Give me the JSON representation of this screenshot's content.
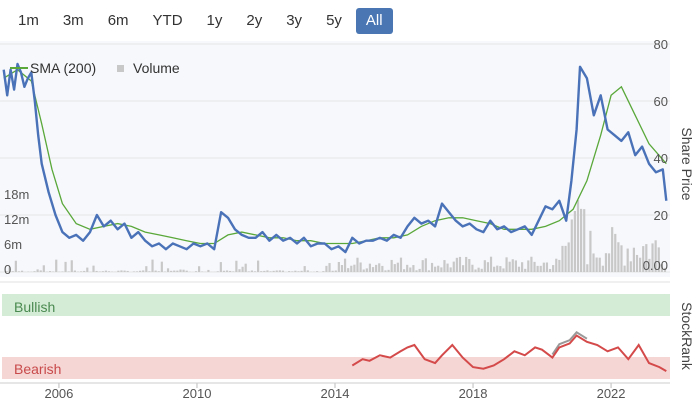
{
  "range_selector": {
    "buttons": [
      "1m",
      "3m",
      "6m",
      "YTD",
      "1y",
      "2y",
      "3y",
      "5y",
      "All"
    ],
    "active": "All"
  },
  "colors": {
    "price": "#4a72b8",
    "sma": "#5aa83a",
    "volume": "#c8c8c8",
    "stockrank_recent": "#d44a4a",
    "stockrank_old": "#999999",
    "bullish_fill": "#d4ecd6",
    "bearish_fill": "#f6d5d5",
    "bullish_text": "#4a8a50",
    "bearish_text": "#c84a4a",
    "button_active": "#4a77b4"
  },
  "chart_data": [
    {
      "type": "line",
      "y_right_label": "Share Price",
      "y_right_ticks": [
        "80",
        "60",
        "40",
        "20",
        "0.00"
      ],
      "y_left_ticks": [
        "18m",
        "12m",
        "6m",
        "0"
      ],
      "x_ticks": [
        "2006",
        "2010",
        "2014",
        "2018",
        "2022"
      ],
      "ylim": [
        0,
        80
      ],
      "volume_ylim": [
        0,
        24
      ],
      "legend": [
        "SMA (200)",
        "Volume"
      ],
      "series": [
        {
          "name": "Share Price",
          "x": [
            2004.4,
            2004.5,
            2004.6,
            2004.7,
            2004.8,
            2004.9,
            2005.0,
            2005.1,
            2005.2,
            2005.3,
            2005.4,
            2005.5,
            2005.7,
            2005.9,
            2006.1,
            2006.3,
            2006.5,
            2006.7,
            2006.9,
            2007.1,
            2007.3,
            2007.5,
            2007.7,
            2007.9,
            2008.1,
            2008.3,
            2008.5,
            2008.7,
            2008.9,
            2009.1,
            2009.3,
            2009.5,
            2009.7,
            2009.9,
            2010.1,
            2010.3,
            2010.5,
            2010.7,
            2010.9,
            2011.1,
            2011.3,
            2011.5,
            2011.7,
            2011.9,
            2012.1,
            2012.3,
            2012.5,
            2012.7,
            2012.9,
            2013.1,
            2013.3,
            2013.5,
            2013.7,
            2013.9,
            2014.1,
            2014.3,
            2014.5,
            2014.7,
            2014.9,
            2015.1,
            2015.3,
            2015.5,
            2015.7,
            2015.9,
            2016.1,
            2016.3,
            2016.5,
            2016.7,
            2016.9,
            2017.1,
            2017.3,
            2017.5,
            2017.7,
            2017.9,
            2018.1,
            2018.3,
            2018.5,
            2018.7,
            2018.9,
            2019.1,
            2019.3,
            2019.5,
            2019.7,
            2019.9,
            2020.1,
            2020.3,
            2020.5,
            2020.7,
            2020.85,
            2021.0,
            2021.1,
            2021.3,
            2021.5,
            2021.7,
            2021.9,
            2022.1,
            2022.3,
            2022.5,
            2022.7,
            2022.9,
            2023.1,
            2023.3,
            2023.5,
            2023.6
          ],
          "values": [
            71,
            62,
            71,
            64,
            73,
            70,
            65,
            68,
            70,
            60,
            48,
            38,
            28,
            20,
            14,
            12,
            13,
            11,
            14,
            20,
            16,
            18,
            15,
            17,
            12,
            14,
            11,
            9,
            10,
            8,
            10,
            9,
            8,
            10,
            9,
            10,
            8,
            21,
            19,
            15,
            13,
            12,
            12,
            14,
            11,
            13,
            11,
            12,
            10,
            12,
            9,
            10,
            10,
            8,
            9,
            7,
            12,
            10,
            11,
            11,
            12,
            11,
            13,
            12,
            16,
            19,
            17,
            18,
            16,
            24,
            21,
            18,
            16,
            17,
            15,
            14,
            18,
            15,
            16,
            14,
            15,
            16,
            13,
            18,
            23,
            22,
            25,
            18,
            32,
            50,
            72,
            68,
            55,
            62,
            50,
            48,
            46,
            49,
            41,
            44,
            38,
            35,
            36,
            25
          ]
        },
        {
          "name": "SMA (200)",
          "x": [
            2004.4,
            2004.8,
            2005.2,
            2005.5,
            2005.8,
            2006.1,
            2006.5,
            2006.9,
            2007.3,
            2007.7,
            2008.1,
            2008.5,
            2008.9,
            2009.3,
            2009.7,
            2010.1,
            2010.5,
            2010.9,
            2011.3,
            2011.7,
            2012.1,
            2012.5,
            2012.9,
            2013.3,
            2013.7,
            2014.1,
            2014.5,
            2014.9,
            2015.3,
            2015.7,
            2016.1,
            2016.5,
            2016.9,
            2017.3,
            2017.7,
            2018.1,
            2018.5,
            2018.9,
            2019.3,
            2019.7,
            2020.1,
            2020.5,
            2020.9,
            2021.3,
            2021.7,
            2022.0,
            2022.3,
            2022.7,
            2023.1,
            2023.6
          ],
          "values": [
            68,
            71,
            67,
            52,
            36,
            24,
            17,
            15,
            16,
            17,
            16,
            14,
            13,
            12,
            11,
            10,
            10,
            13,
            14,
            13,
            12,
            12,
            11,
            11,
            10,
            10,
            10,
            11,
            12,
            12,
            13,
            16,
            18,
            19,
            19,
            18,
            17,
            15,
            15,
            15,
            16,
            18,
            22,
            32,
            48,
            62,
            65,
            55,
            45,
            38
          ]
        }
      ]
    },
    {
      "type": "line",
      "title": "StockRank",
      "bands": [
        "Bullish",
        "Bearish"
      ],
      "ylim": [
        0,
        100
      ],
      "series": [
        {
          "name": "StockRank",
          "x": [
            2014.5,
            2014.8,
            2015.0,
            2015.3,
            2015.6,
            2015.9,
            2016.1,
            2016.3,
            2016.6,
            2016.9,
            2017.1,
            2017.4,
            2017.7,
            2018.0,
            2018.3,
            2018.6,
            2018.9,
            2019.2,
            2019.5,
            2019.8,
            2020.0,
            2020.3,
            2020.5,
            2020.8,
            2021.0,
            2021.3,
            2021.6,
            2021.9,
            2022.2,
            2022.5,
            2022.8,
            2023.1,
            2023.4,
            2023.6
          ],
          "values": [
            12,
            20,
            18,
            25,
            22,
            30,
            35,
            38,
            20,
            15,
            25,
            38,
            22,
            10,
            8,
            12,
            20,
            30,
            25,
            35,
            32,
            22,
            35,
            40,
            50,
            42,
            38,
            30,
            35,
            20,
            38,
            15,
            10,
            5
          ]
        }
      ]
    }
  ]
}
